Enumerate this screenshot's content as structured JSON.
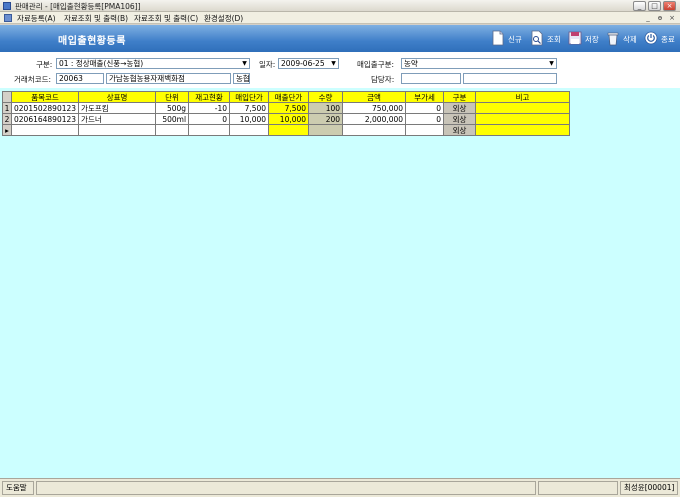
{
  "window": {
    "title": "판매관리 - [매입출현황등록[PMA106]]",
    "minimize": "_",
    "maximize": "□",
    "close": "×"
  },
  "menu": {
    "items": [
      "자료등록(A)",
      "자료조회 및 출력(B)",
      "자료조회 및 출력(C)",
      "환경설정(D)"
    ],
    "mdi_min": "_",
    "mdi_restore": "ɵ",
    "mdi_close": "×"
  },
  "header": {
    "form_title": "매입출현황등록",
    "toolbar": {
      "new_label": "신규",
      "query_label": "조회",
      "save_label": "저장",
      "delete_label": "삭제",
      "exit_label": "종료"
    }
  },
  "form": {
    "category_label": "구분:",
    "category_value": "01 : 정상매출(신풍→농협)",
    "date_label": "일자:",
    "date_value": "2009-06-25",
    "dept_label": "매입출구분:",
    "dept_value": "농약",
    "client_code_label": "거래처코드:",
    "client_code_value": "20063",
    "client_name_value": "가남농협농용자재백화점",
    "client_type_value": "농협",
    "manager_label": "담당자:",
    "manager_code_value": "",
    "manager_name_value": ""
  },
  "grid": {
    "columns": [
      "품목코드",
      "상표명",
      "단위",
      "재고현황",
      "매입단가",
      "매출단가",
      "수량",
      "금액",
      "부가세",
      "구분",
      "비고"
    ],
    "rows": [
      {
        "num": "1",
        "code": "0201502890123",
        "name": "가도프킴",
        "unit": "500g",
        "stock": "-10",
        "buy_price": "7,500",
        "sell_price": "7,500",
        "qty": "100",
        "amount": "750,000",
        "vat": "0",
        "type": "외상",
        "note": ""
      },
      {
        "num": "2",
        "code": "0206164890123",
        "name": "가드너",
        "unit": "500ml",
        "stock": "0",
        "buy_price": "10,000",
        "sell_price": "10,000",
        "qty": "200",
        "amount": "2,000,000",
        "vat": "0",
        "type": "외상",
        "note": ""
      },
      {
        "num": "▸",
        "code": "",
        "name": "",
        "unit": "",
        "stock": "",
        "buy_price": "",
        "sell_price": "",
        "qty": "",
        "amount": "",
        "vat": "",
        "type": "외상",
        "note": ""
      }
    ]
  },
  "status": {
    "left": "도움말",
    "user": "최성윤[00001]"
  },
  "colors": {
    "banner": "#3f7fc9",
    "grid_header": "#ffff00",
    "grid_bg": "#ccffff"
  }
}
